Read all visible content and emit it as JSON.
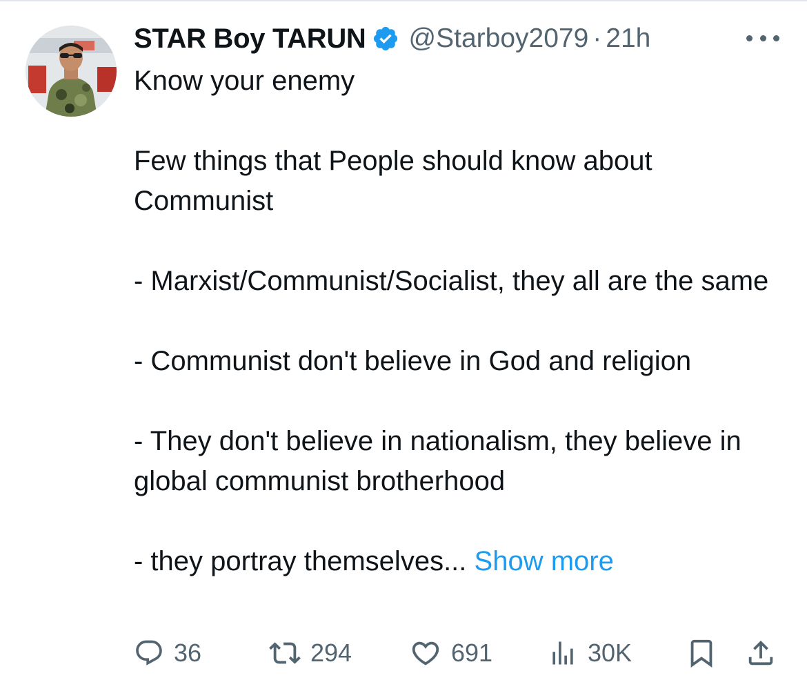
{
  "tweet": {
    "author": {
      "display_name": "STAR Boy TARUN",
      "handle": "@Starboy2079",
      "verified": true,
      "time_separator": "·",
      "timestamp": "21h"
    },
    "body": {
      "line1": "Know your enemy",
      "line2": "Few things that People should know about Communist",
      "line3": "- Marxist/Communist/Socialist, they all are the same",
      "line4": "- Communist don't believe in God and religion",
      "line5": "- They don't believe in nationalism, they believe in global communist brotherhood",
      "line6": "- they portray themselves...",
      "show_more": "Show more"
    },
    "actions": {
      "replies": "36",
      "reposts": "294",
      "likes": "691",
      "views": "30K"
    },
    "icons": {
      "verified": "verified-badge-icon",
      "more": "more-icon",
      "reply": "reply-icon",
      "repost": "repost-icon",
      "like": "heart-icon",
      "views": "views-icon",
      "bookmark": "bookmark-icon",
      "share": "share-icon"
    },
    "colors": {
      "accent": "#1d9bf0",
      "secondary_text": "#536471",
      "primary_text": "#0f1419"
    }
  }
}
